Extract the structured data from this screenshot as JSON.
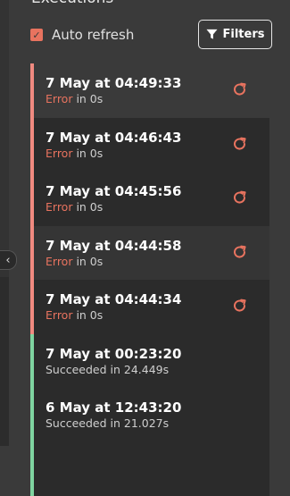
{
  "header": {
    "title": "Executions"
  },
  "autorefresh": {
    "label": "Auto refresh",
    "checked": true
  },
  "filters": {
    "label": "Filters"
  },
  "colors": {
    "error": "#e8735f",
    "error_bar": "#f08a80",
    "success_bar": "#7fd4a0",
    "accent": "#e8735f"
  },
  "executions": [
    {
      "time": "7 May at 04:49:33",
      "status_word": "Error",
      "status_rest": " in 0s",
      "result": "error"
    },
    {
      "time": "7 May at 04:46:43",
      "status_word": "Error",
      "status_rest": " in 0s",
      "result": "error"
    },
    {
      "time": "7 May at 04:45:56",
      "status_word": "Error",
      "status_rest": " in 0s",
      "result": "error"
    },
    {
      "time": "7 May at 04:44:58",
      "status_word": "Error",
      "status_rest": " in 0s",
      "result": "error"
    },
    {
      "time": "7 May at 04:44:34",
      "status_word": "Error",
      "status_rest": " in 0s",
      "result": "error"
    },
    {
      "time": "7 May at 00:23:20",
      "status_word": "",
      "status_rest": "Succeeded in 24.449s",
      "result": "success"
    },
    {
      "time": "6 May at 12:43:20",
      "status_word": "",
      "status_rest": "Succeeded in 21.027s",
      "result": "success"
    },
    {
      "time": "",
      "status_word": "",
      "status_rest": "",
      "result": "success"
    }
  ]
}
